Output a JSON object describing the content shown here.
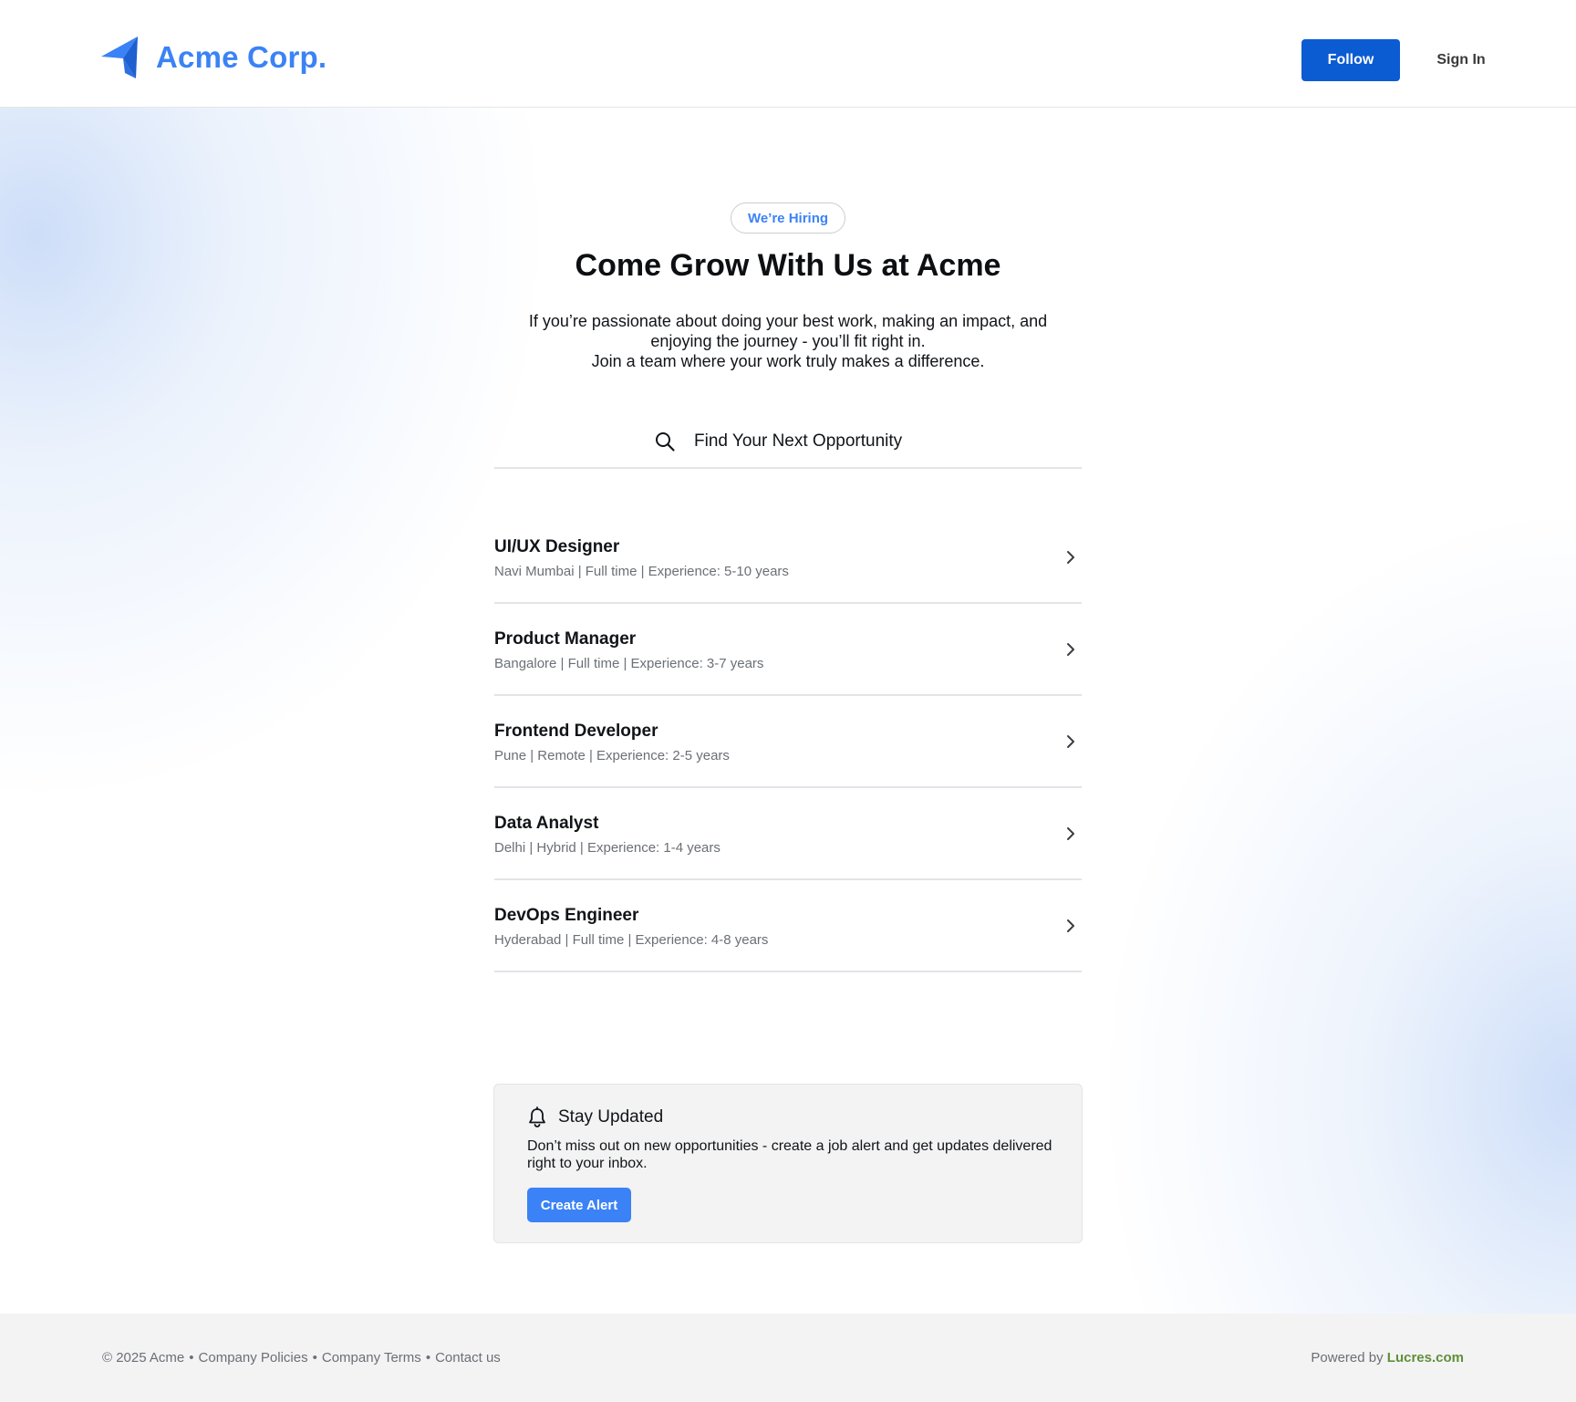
{
  "header": {
    "brand_name": "Acme Corp.",
    "logo_icon": "paper-plane-icon",
    "follow_label": "Follow",
    "signin_label": "Sign In"
  },
  "hero": {
    "badge": "We’re Hiring",
    "title": "Come Grow With Us at Acme",
    "description_line1": "If you’re passionate about doing your best work, making an impact, and",
    "description_line2": "enjoying the journey - you’ll fit right in.",
    "description_line3": "Join a team where your work truly makes a difference.",
    "search_placeholder": "Find Your Next Opportunity",
    "search_value": ""
  },
  "jobs": [
    {
      "title": "UI/UX Designer",
      "meta": "Navi Mumbai | Full time | Experience: 5-10 years"
    },
    {
      "title": "Product Manager",
      "meta": "Bangalore | Full time | Experience: 3-7 years"
    },
    {
      "title": "Frontend Developer",
      "meta": "Pune | Remote | Experience: 2-5 years"
    },
    {
      "title": "Data Analyst",
      "meta": "Delhi | Hybrid | Experience: 1-4 years"
    },
    {
      "title": "DevOps Engineer",
      "meta": "Hyderabad | Full time | Experience: 4-8 years"
    }
  ],
  "alert": {
    "icon": "bell-icon",
    "title": "Stay Updated",
    "description": "Don’t miss out on new opportunities - create a job alert and get updates delivered right to your inbox.",
    "button_label": "Create Alert"
  },
  "footer": {
    "copyright": "© 2025 Acme",
    "separator": "•",
    "links": [
      "Company Policies",
      "Company Terms",
      "Contact us"
    ],
    "powered_prefix": "Powered by",
    "powered_link": "Lucres.com"
  },
  "colors": {
    "brand_blue": "#3b82f6",
    "follow_blue": "#0b5bd3",
    "powered_green": "#5f8f3a"
  }
}
